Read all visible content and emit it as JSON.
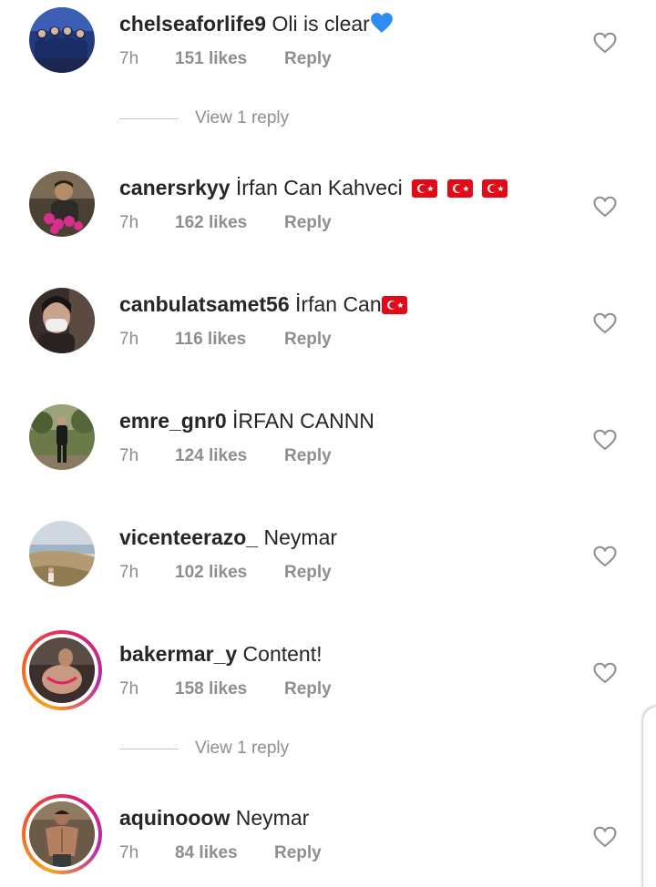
{
  "comments": [
    {
      "username": "chelseaforlife9",
      "text": "Oli is clear",
      "emoji": "blue-heart",
      "time": "7h",
      "likes": "151 likes",
      "reply": "Reply",
      "story_ring": false,
      "avatar": "team-photo"
    },
    {
      "username": "canersrkyy",
      "text": "İrfan Can Kahveci",
      "flags": [
        "🇹🇷",
        "🇹🇷",
        "🇹🇷"
      ],
      "time": "7h",
      "likes": "162 likes",
      "reply": "Reply",
      "story_ring": false,
      "avatar": "person-with-flowers"
    },
    {
      "username": "canbulatsamet56",
      "text": "İrfan Can",
      "flags": [
        "🇹🇷"
      ],
      "time": "7h",
      "likes": "116 likes",
      "reply": "Reply",
      "story_ring": false,
      "avatar": "masked-selfie"
    },
    {
      "username": "emre_gnr0",
      "text": "İRFAN CANNN",
      "time": "7h",
      "likes": "124 likes",
      "reply": "Reply",
      "story_ring": false,
      "avatar": "person-standing-outdoors"
    },
    {
      "username": "vicenteerazo_",
      "text": "Neymar",
      "time": "7h",
      "likes": "102 likes",
      "reply": "Reply",
      "story_ring": false,
      "avatar": "coastal-landscape"
    },
    {
      "username": "bakermar_y",
      "text": "Content!",
      "time": "7h",
      "likes": "158 likes",
      "reply": "Reply",
      "story_ring": true,
      "avatar": "photo"
    },
    {
      "username": "aquinooow",
      "text": "Neymar",
      "time": "7h",
      "likes": "84 likes",
      "reply": "Reply",
      "story_ring": true,
      "avatar": "fitness-photo"
    }
  ],
  "view_replies": [
    {
      "label": "View 1 reply"
    },
    {
      "label": "View 1 reply"
    }
  ],
  "colors": {
    "username": "#262626",
    "meta": "#8e8e8e",
    "divider": "#c7c7c7",
    "blue_heart": "#2d8ef0",
    "turkey_red": "#e30a17"
  },
  "icons": {
    "like": "heart-outline-icon",
    "emoji": "blue-heart-emoji",
    "flag": "turkey-flag-emoji"
  }
}
